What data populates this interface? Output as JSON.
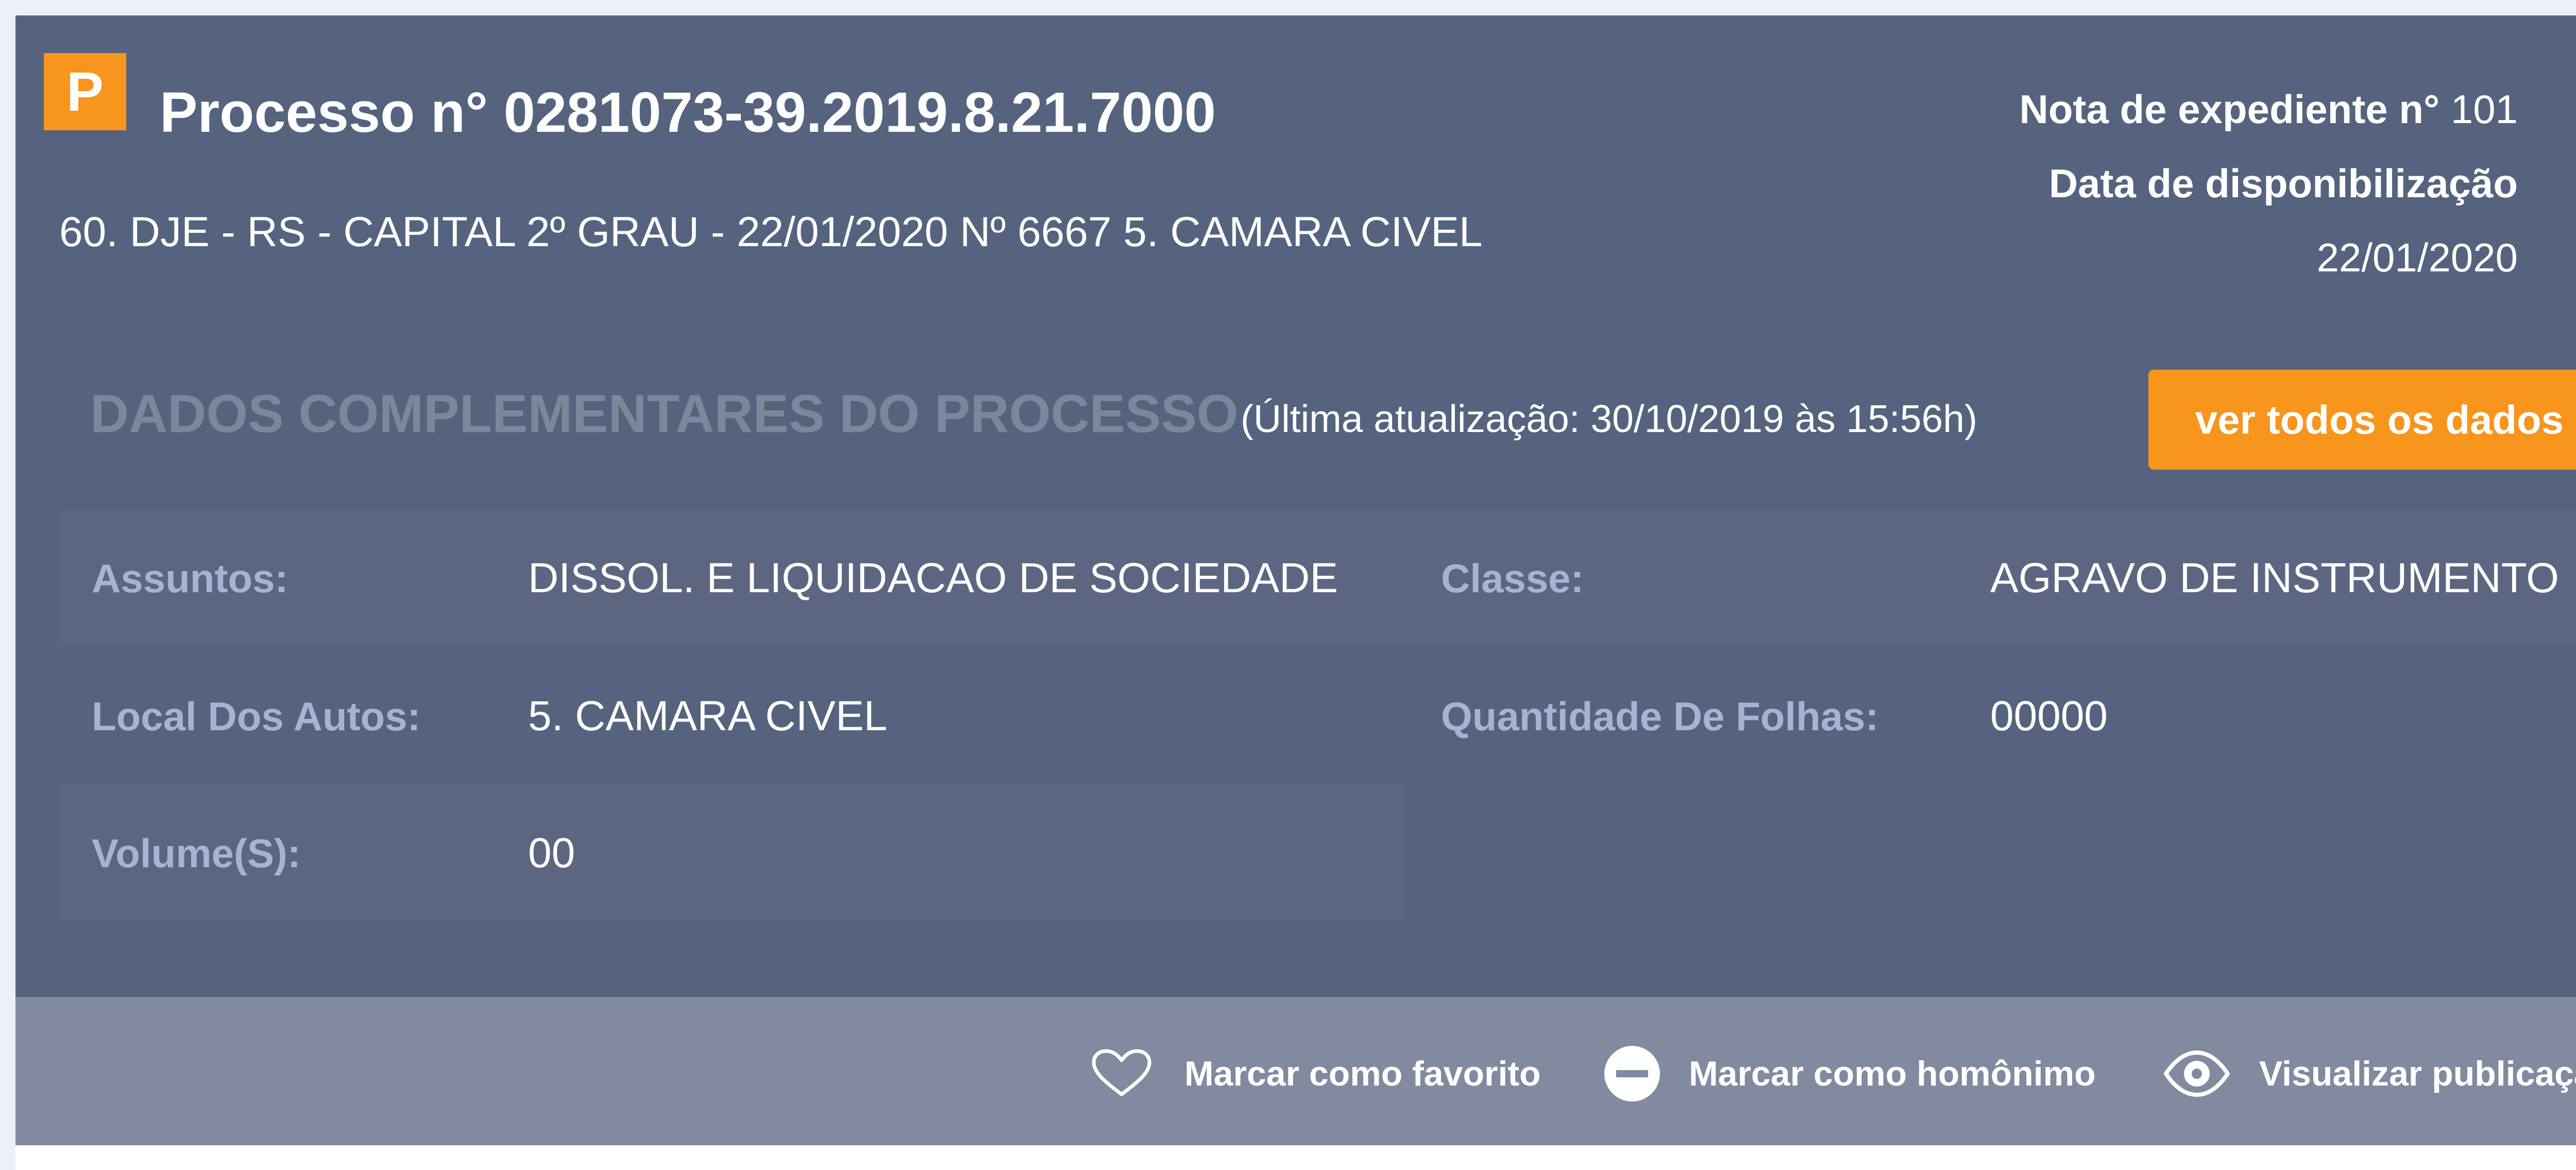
{
  "header": {
    "badge": "P",
    "title": "Processo n° 0281073-39.2019.8.21.7000",
    "subtitle": "60. DJE - RS - CAPITAL 2º GRAU - 22/01/2020 Nº 6667 5. CAMARA CIVEL",
    "nota_label": "Nota de expediente n°",
    "nota_value": "101",
    "data_label": "Data de disponibilização",
    "data_value": "22/01/2020"
  },
  "section": {
    "title": "DADOS COMPLEMENTARES DO PROCESSO",
    "update": "(Última atualização: 30/10/2019 às 15:56h)",
    "button": "ver todos os dados"
  },
  "fields": {
    "assuntos": {
      "label": "Assuntos:",
      "value": "DISSOL. E LIQUIDACAO DE SOCIEDADE"
    },
    "classe": {
      "label": "Classe:",
      "value": "AGRAVO DE INSTRUMENTO"
    },
    "local": {
      "label": "Local Dos Autos:",
      "value": "5. CAMARA CIVEL"
    },
    "folhas": {
      "label": "Quantidade De Folhas:",
      "value": "00000"
    },
    "volume": {
      "label": "Volume(S):",
      "value": "00"
    }
  },
  "actions": {
    "favorito": {
      "label": "Marcar como favorito",
      "icon": "heart-icon"
    },
    "homonimo": {
      "label": "Marcar como homônimo",
      "icon": "minus-circle-icon"
    },
    "visualizar": {
      "label": "Visualizar publicação",
      "icon": "eye-icon"
    }
  },
  "colors": {
    "card_background": "#55637e",
    "accent_orange": "#f7951d",
    "footer_background": "#818a9f",
    "label_color": "#a9b2d2"
  }
}
